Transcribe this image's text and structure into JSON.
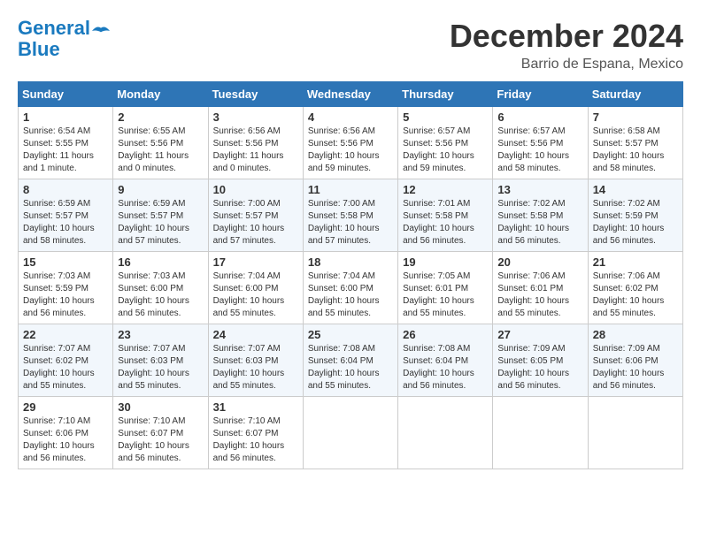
{
  "logo": {
    "line1": "General",
    "line2": "Blue"
  },
  "title": "December 2024",
  "subtitle": "Barrio de Espana, Mexico",
  "days_of_week": [
    "Sunday",
    "Monday",
    "Tuesday",
    "Wednesday",
    "Thursday",
    "Friday",
    "Saturday"
  ],
  "weeks": [
    [
      {
        "day": "1",
        "info": "Sunrise: 6:54 AM\nSunset: 5:55 PM\nDaylight: 11 hours\nand 1 minute."
      },
      {
        "day": "2",
        "info": "Sunrise: 6:55 AM\nSunset: 5:56 PM\nDaylight: 11 hours\nand 0 minutes."
      },
      {
        "day": "3",
        "info": "Sunrise: 6:56 AM\nSunset: 5:56 PM\nDaylight: 11 hours\nand 0 minutes."
      },
      {
        "day": "4",
        "info": "Sunrise: 6:56 AM\nSunset: 5:56 PM\nDaylight: 10 hours\nand 59 minutes."
      },
      {
        "day": "5",
        "info": "Sunrise: 6:57 AM\nSunset: 5:56 PM\nDaylight: 10 hours\nand 59 minutes."
      },
      {
        "day": "6",
        "info": "Sunrise: 6:57 AM\nSunset: 5:56 PM\nDaylight: 10 hours\nand 58 minutes."
      },
      {
        "day": "7",
        "info": "Sunrise: 6:58 AM\nSunset: 5:57 PM\nDaylight: 10 hours\nand 58 minutes."
      }
    ],
    [
      {
        "day": "8",
        "info": "Sunrise: 6:59 AM\nSunset: 5:57 PM\nDaylight: 10 hours\nand 58 minutes."
      },
      {
        "day": "9",
        "info": "Sunrise: 6:59 AM\nSunset: 5:57 PM\nDaylight: 10 hours\nand 57 minutes."
      },
      {
        "day": "10",
        "info": "Sunrise: 7:00 AM\nSunset: 5:57 PM\nDaylight: 10 hours\nand 57 minutes."
      },
      {
        "day": "11",
        "info": "Sunrise: 7:00 AM\nSunset: 5:58 PM\nDaylight: 10 hours\nand 57 minutes."
      },
      {
        "day": "12",
        "info": "Sunrise: 7:01 AM\nSunset: 5:58 PM\nDaylight: 10 hours\nand 56 minutes."
      },
      {
        "day": "13",
        "info": "Sunrise: 7:02 AM\nSunset: 5:58 PM\nDaylight: 10 hours\nand 56 minutes."
      },
      {
        "day": "14",
        "info": "Sunrise: 7:02 AM\nSunset: 5:59 PM\nDaylight: 10 hours\nand 56 minutes."
      }
    ],
    [
      {
        "day": "15",
        "info": "Sunrise: 7:03 AM\nSunset: 5:59 PM\nDaylight: 10 hours\nand 56 minutes."
      },
      {
        "day": "16",
        "info": "Sunrise: 7:03 AM\nSunset: 6:00 PM\nDaylight: 10 hours\nand 56 minutes."
      },
      {
        "day": "17",
        "info": "Sunrise: 7:04 AM\nSunset: 6:00 PM\nDaylight: 10 hours\nand 55 minutes."
      },
      {
        "day": "18",
        "info": "Sunrise: 7:04 AM\nSunset: 6:00 PM\nDaylight: 10 hours\nand 55 minutes."
      },
      {
        "day": "19",
        "info": "Sunrise: 7:05 AM\nSunset: 6:01 PM\nDaylight: 10 hours\nand 55 minutes."
      },
      {
        "day": "20",
        "info": "Sunrise: 7:06 AM\nSunset: 6:01 PM\nDaylight: 10 hours\nand 55 minutes."
      },
      {
        "day": "21",
        "info": "Sunrise: 7:06 AM\nSunset: 6:02 PM\nDaylight: 10 hours\nand 55 minutes."
      }
    ],
    [
      {
        "day": "22",
        "info": "Sunrise: 7:07 AM\nSunset: 6:02 PM\nDaylight: 10 hours\nand 55 minutes."
      },
      {
        "day": "23",
        "info": "Sunrise: 7:07 AM\nSunset: 6:03 PM\nDaylight: 10 hours\nand 55 minutes."
      },
      {
        "day": "24",
        "info": "Sunrise: 7:07 AM\nSunset: 6:03 PM\nDaylight: 10 hours\nand 55 minutes."
      },
      {
        "day": "25",
        "info": "Sunrise: 7:08 AM\nSunset: 6:04 PM\nDaylight: 10 hours\nand 55 minutes."
      },
      {
        "day": "26",
        "info": "Sunrise: 7:08 AM\nSunset: 6:04 PM\nDaylight: 10 hours\nand 56 minutes."
      },
      {
        "day": "27",
        "info": "Sunrise: 7:09 AM\nSunset: 6:05 PM\nDaylight: 10 hours\nand 56 minutes."
      },
      {
        "day": "28",
        "info": "Sunrise: 7:09 AM\nSunset: 6:06 PM\nDaylight: 10 hours\nand 56 minutes."
      }
    ],
    [
      {
        "day": "29",
        "info": "Sunrise: 7:10 AM\nSunset: 6:06 PM\nDaylight: 10 hours\nand 56 minutes."
      },
      {
        "day": "30",
        "info": "Sunrise: 7:10 AM\nSunset: 6:07 PM\nDaylight: 10 hours\nand 56 minutes."
      },
      {
        "day": "31",
        "info": "Sunrise: 7:10 AM\nSunset: 6:07 PM\nDaylight: 10 hours\nand 56 minutes."
      },
      {
        "day": "",
        "info": ""
      },
      {
        "day": "",
        "info": ""
      },
      {
        "day": "",
        "info": ""
      },
      {
        "day": "",
        "info": ""
      }
    ]
  ]
}
